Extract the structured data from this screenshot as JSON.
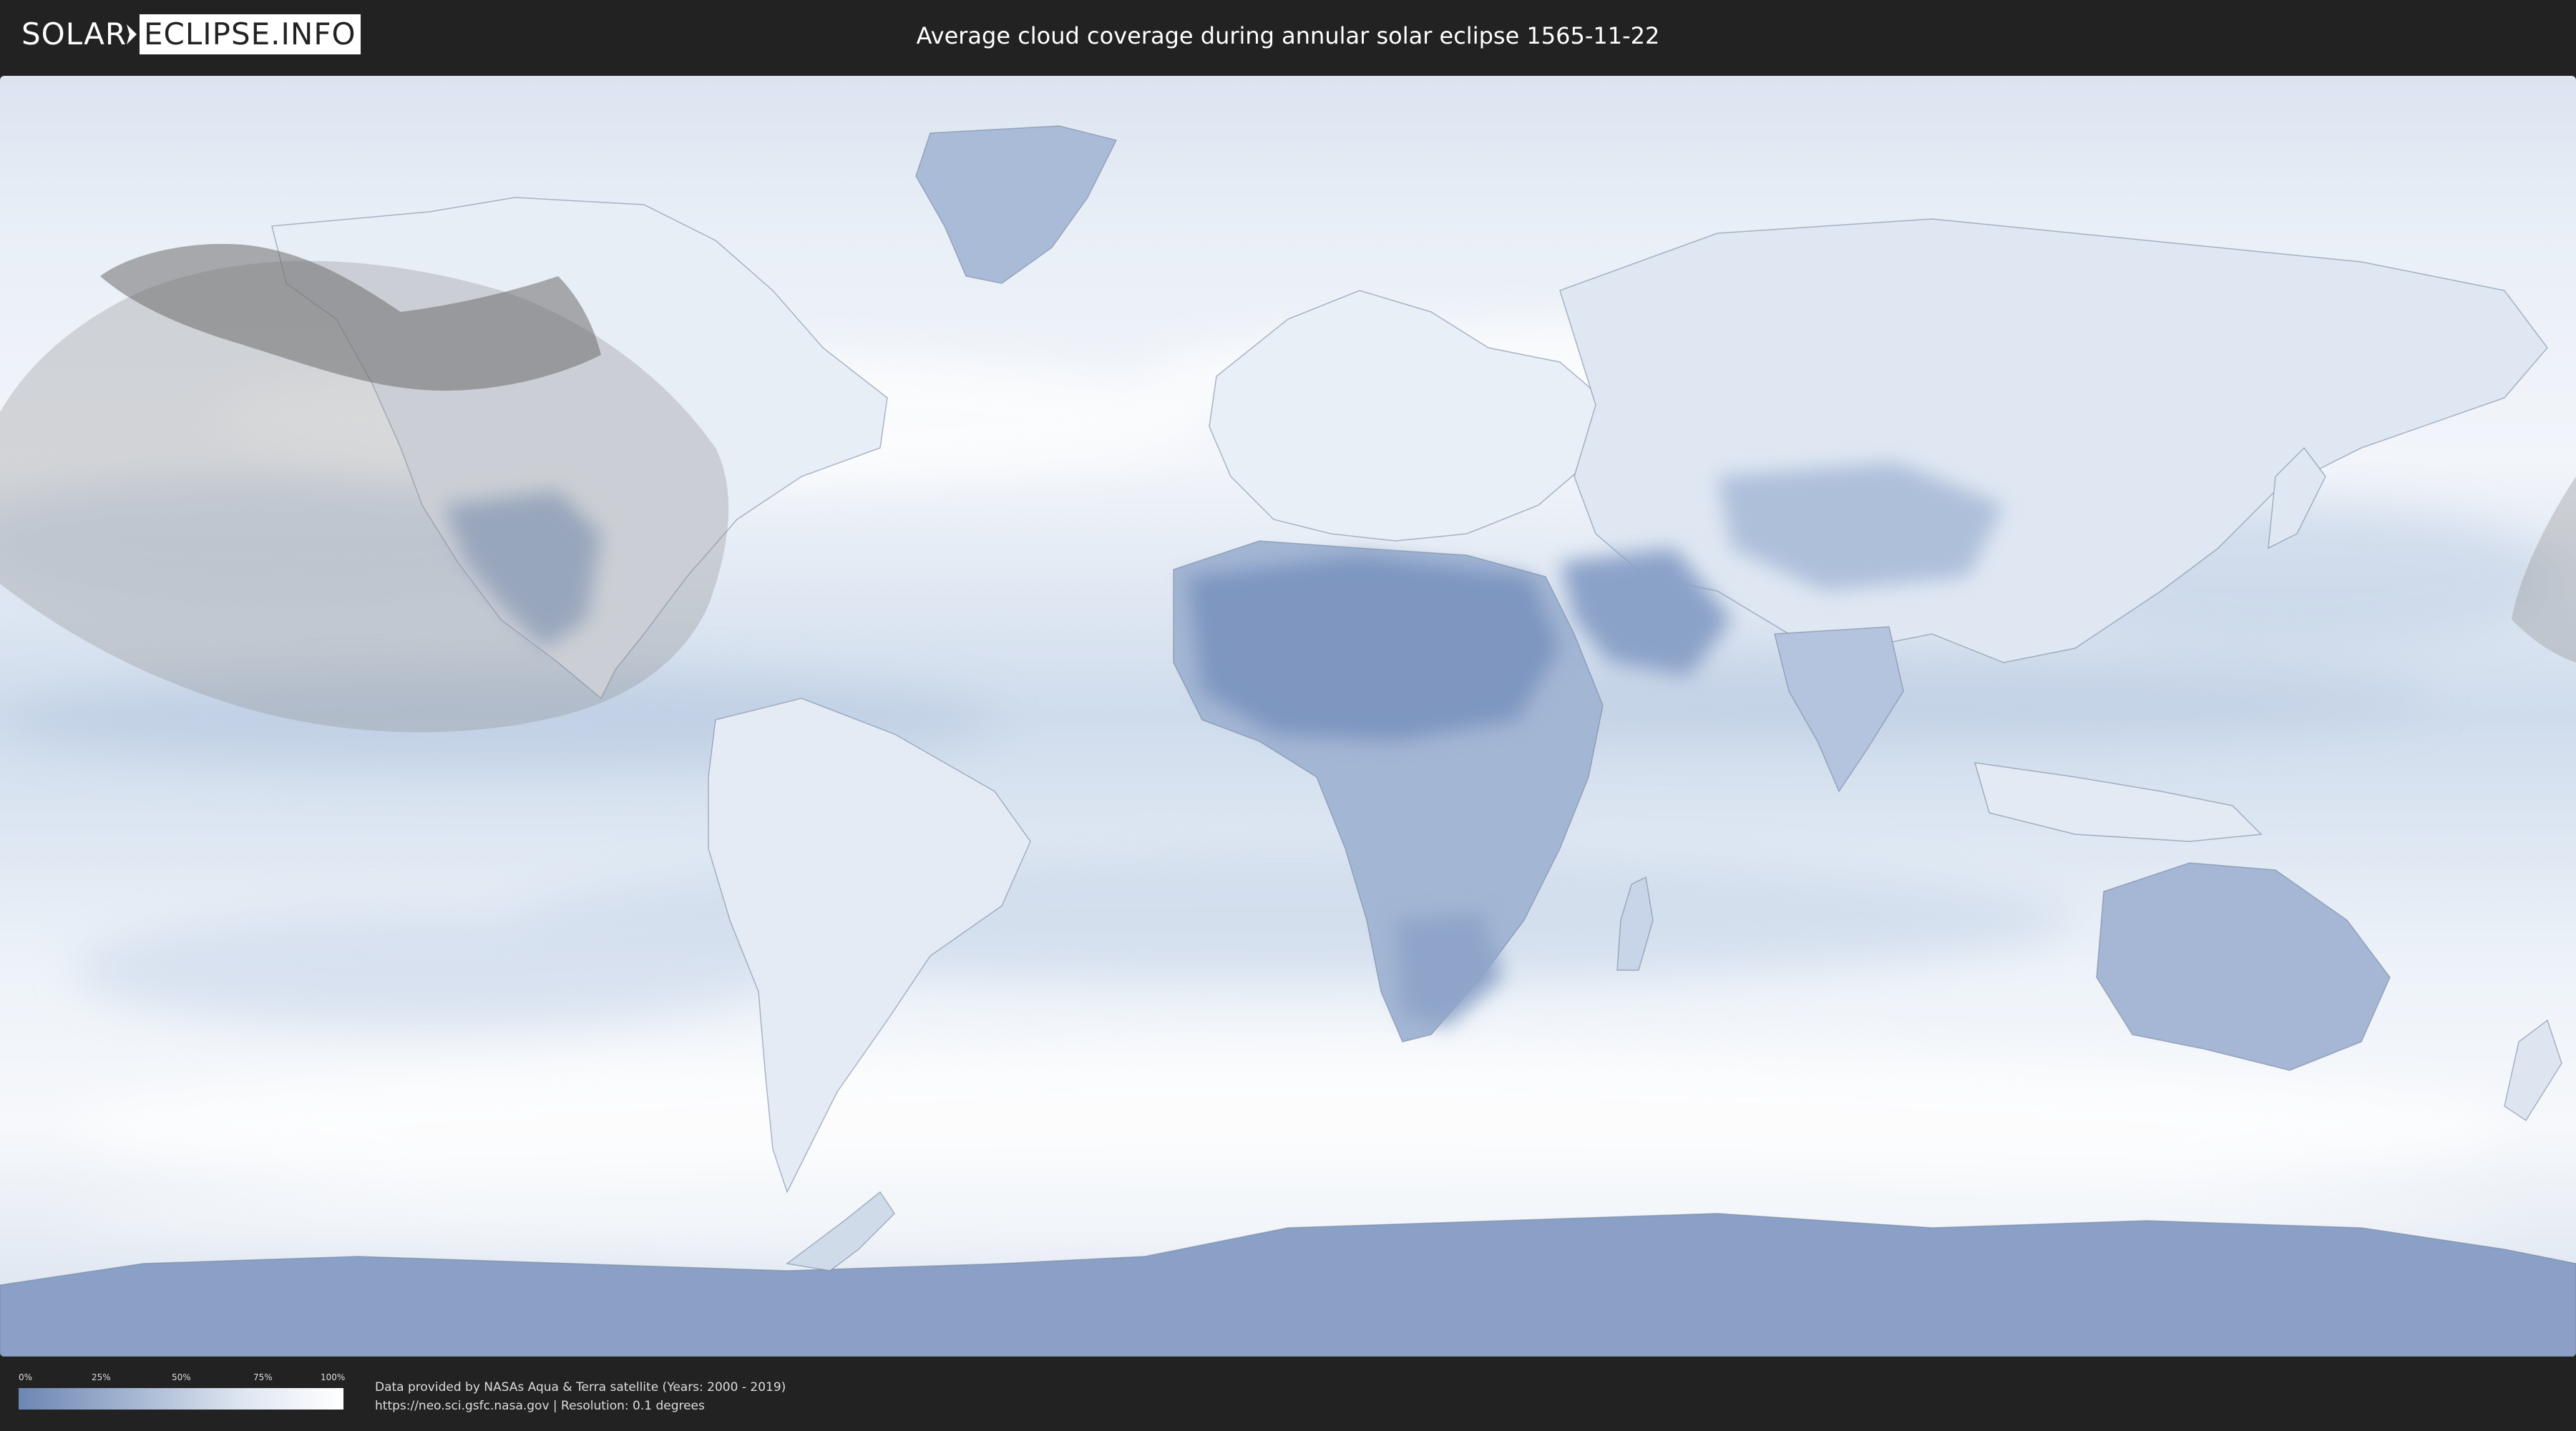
{
  "header": {
    "logo_left": "SOLAR",
    "logo_right": "ECLIPSE.INFO",
    "title": "Average cloud coverage during annular solar eclipse 1565-11-22"
  },
  "legend": {
    "ticks": [
      "0%",
      "25%",
      "50%",
      "75%",
      "100%"
    ],
    "colors": {
      "low": "#6d86b2",
      "mid": "#a5b6d2",
      "high": "#ffffff"
    }
  },
  "credits": {
    "line1": "Data provided by NASAs Aqua & Terra satellite (Years: 2000 - 2019)",
    "line2": "https://neo.sci.gsfc.nasa.gov | Resolution: 0.1 degrees"
  },
  "colors": {
    "background": "#222222",
    "ocean_cloud": "#c9d6e8",
    "dense_cloud": "#f4f7fb",
    "clear_land": "#7b94bf",
    "eclipse_shadow": "#9a9a9a"
  }
}
